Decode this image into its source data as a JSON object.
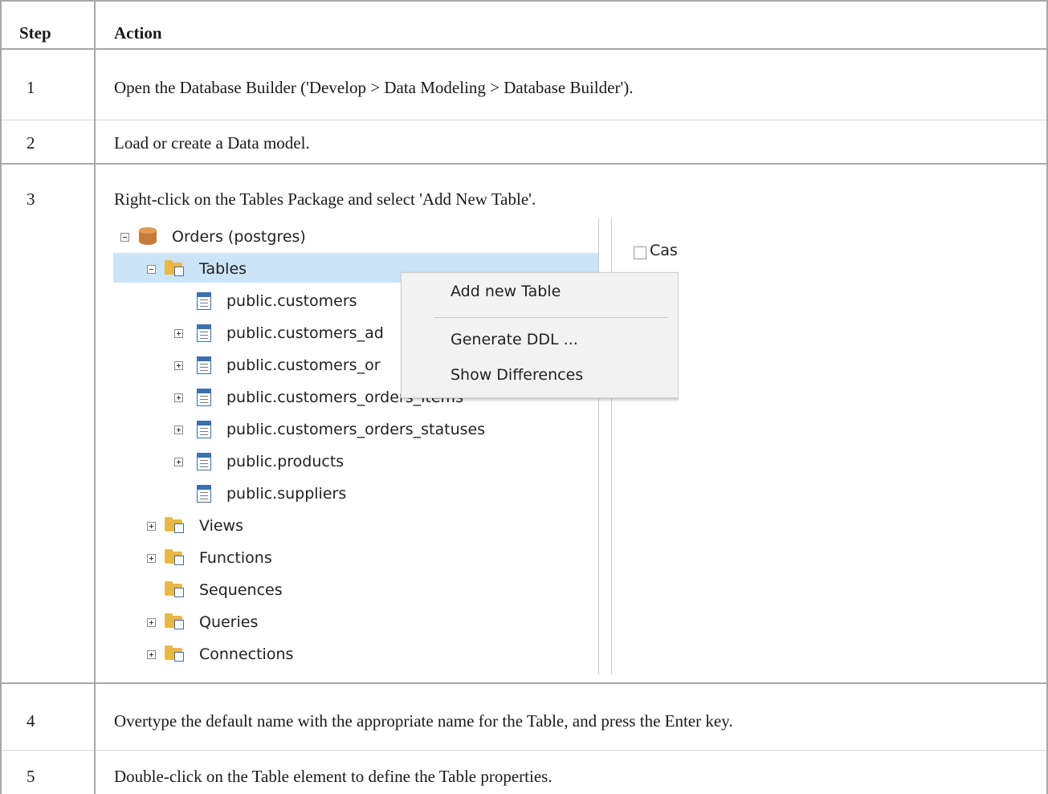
{
  "table": {
    "headers": {
      "step": "Step",
      "action": "Action"
    },
    "rows": [
      {
        "step": "1",
        "action": "Open the Database Builder ('Develop > Data Modeling > Database Builder')."
      },
      {
        "step": "2",
        "action": "Load or create a Data model."
      },
      {
        "step": "3",
        "action": "Right-click on the Tables Package and select 'Add New Table'."
      },
      {
        "step": "4",
        "action": "Overtype the default name with the appropriate name for the Table, and press the Enter key."
      },
      {
        "step": "5",
        "action": "Double-click on the Table element to define the Table properties."
      }
    ]
  },
  "screenshot": {
    "root": "Orders (postgres)",
    "tables_folder": "Tables",
    "tables": [
      "public.customers",
      "public.customers_ad",
      "public.customers_or",
      "public.customers_orders_items",
      "public.customers_orders_statuses",
      "public.products",
      "public.suppliers"
    ],
    "folders": [
      "Views",
      "Functions",
      "Sequences",
      "Queries",
      "Connections"
    ],
    "checkbox_label": "Cas",
    "context_menu": {
      "add_new_table": "Add new Table",
      "generate_ddl": "Generate DDL ...",
      "show_differences": "Show Differences"
    }
  }
}
